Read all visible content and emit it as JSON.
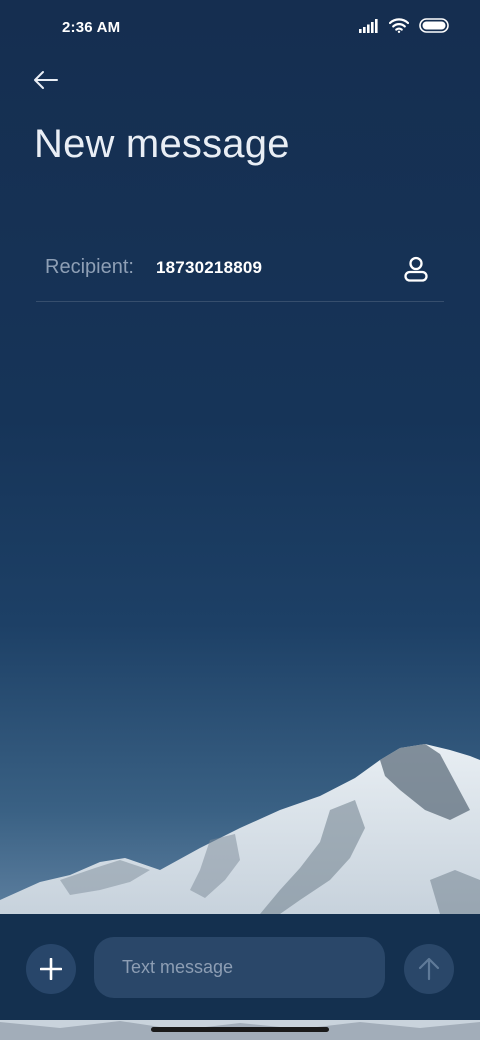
{
  "status_bar": {
    "time": "2:36 AM",
    "icons": [
      "signal-icon",
      "wifi-icon",
      "battery-icon"
    ]
  },
  "header": {
    "back_icon": "back-arrow-icon",
    "title": "New message"
  },
  "recipient": {
    "label": "Recipient:",
    "value": "18730218809",
    "contact_icon": "contact-person-icon"
  },
  "composer": {
    "add_icon": "plus-icon",
    "placeholder": "Text message",
    "value": "",
    "send_icon": "send-arrow-up-icon"
  },
  "colors": {
    "background_top": "#152e50",
    "composer_bar": "#14304f",
    "input_fill": "#2a4769",
    "muted_text": "#8e9fb5"
  }
}
